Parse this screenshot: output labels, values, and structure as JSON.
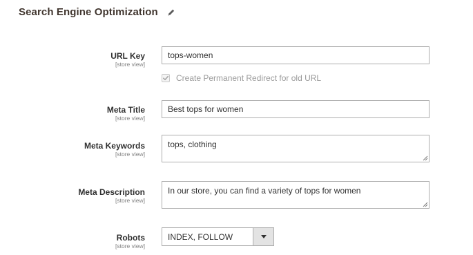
{
  "section": {
    "title": "Search Engine Optimization",
    "edit_icon": "pencil-icon"
  },
  "scope_label": "[store view]",
  "fields": {
    "url_key": {
      "label": "URL Key",
      "scope": "[store view]",
      "value": "tops-women"
    },
    "redirect": {
      "label": "Create Permanent Redirect for old URL",
      "checked": true,
      "disabled": true
    },
    "meta_title": {
      "label": "Meta Title",
      "scope": "[store view]",
      "value": "Best tops for women"
    },
    "meta_keywords": {
      "label": "Meta Keywords",
      "scope": "[store view]",
      "value": "tops, clothing"
    },
    "meta_description": {
      "label": "Meta Description",
      "scope": "[store view]",
      "value": "In our store, you can find a variety of tops for women"
    },
    "robots": {
      "label": "Robots",
      "scope": "[store view]",
      "value": "INDEX, FOLLOW"
    }
  },
  "colors": {
    "title": "#41362f",
    "border": "#adadad",
    "muted": "#808080",
    "select_button": "#e3e3e3"
  }
}
